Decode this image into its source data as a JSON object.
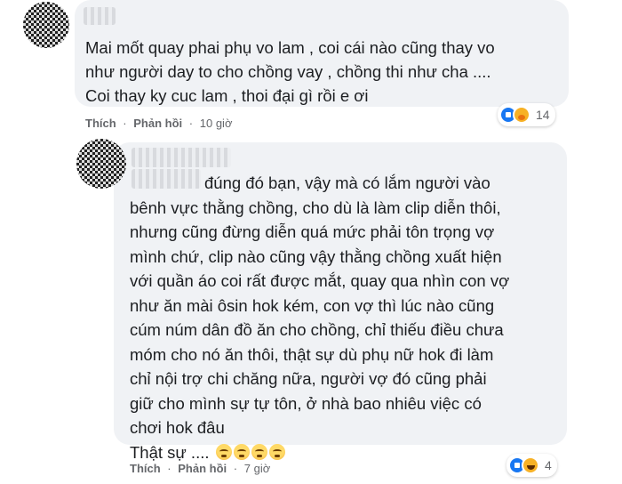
{
  "comments": [
    {
      "text_lines": [
        "Mai mốt quay phai phụ vo lam , coi cái nào cũng thay vo",
        "như người day to cho chồng vay , chồng thi như cha ....",
        "Coi thay ky cuc lam , thoi đại gì rồi e ơi"
      ],
      "actions": {
        "like": "Thích",
        "reply": "Phản hồi",
        "separator": "·",
        "time": "10 giờ"
      },
      "reactions": {
        "icons": [
          "like-icon",
          "care-icon"
        ],
        "count": "14"
      }
    },
    {
      "text_lines": [
        "đúng đó bạn, vậy mà có lắm người vào",
        "bênh vực thằng chồng, cho dù là làm clip diễn thôi,",
        "nhưng cũng đừng diễn quá mức phải tôn trọng vợ",
        "mình chứ, clip nào cũng vậy thằng chồng xuất hiện",
        "với quần áo coi rất được mắt, quay qua nhìn con vợ",
        "như ăn mài ôsin hok kém, con vợ thì lúc nào cũng",
        "cúm núm dân đồ ăn cho chồng, chỉ thiếu điều chưa",
        "móm cho nó ăn thôi, thật sự dù phụ nữ hok đi làm",
        "chỉ nội trợ chi chăng nữa, người vợ đó cũng phải",
        "giữ cho mình sự tự tôn, ở nhà bao nhiêu việc có",
        "chơi hok đâu"
      ],
      "last_line": "Thật sự ....",
      "last_line_emojis": [
        "sad-face-icon",
        "sad-face-icon",
        "sad-face-icon",
        "sad-face-icon"
      ],
      "actions": {
        "like": "Thích",
        "reply": "Phản hồi",
        "separator": "·",
        "time": "7 giờ"
      },
      "reactions": {
        "icons": [
          "like-icon",
          "haha-icon"
        ],
        "count": "4"
      }
    }
  ],
  "colors": {
    "bubble": "#f0f2f5",
    "meta_text": "#65676b",
    "like_blue": "#1877f2",
    "reaction_yellow": "#f7b125"
  }
}
